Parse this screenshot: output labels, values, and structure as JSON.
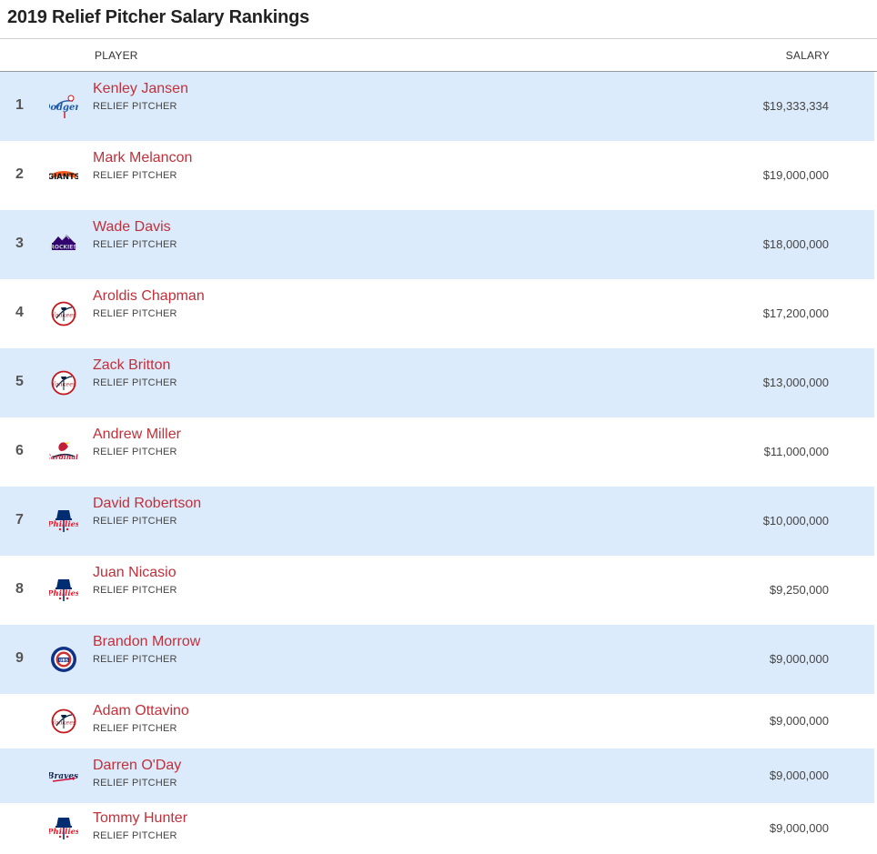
{
  "page": {
    "title": "2019 Relief Pitcher Salary Rankings"
  },
  "table": {
    "headers": {
      "player": "PLAYER",
      "salary": "SALARY"
    },
    "rows": [
      {
        "rank": "1",
        "name": "Kenley Jansen",
        "position": "RELIEF PITCHER",
        "salary": "$19,333,334",
        "team_icon": "dodgers-logo-icon"
      },
      {
        "rank": "2",
        "name": "Mark Melancon",
        "position": "RELIEF PITCHER",
        "salary": "$19,000,000",
        "team_icon": "giants-logo-icon"
      },
      {
        "rank": "3",
        "name": "Wade Davis",
        "position": "RELIEF PITCHER",
        "salary": "$18,000,000",
        "team_icon": "rockies-logo-icon"
      },
      {
        "rank": "4",
        "name": "Aroldis Chapman",
        "position": "RELIEF PITCHER",
        "salary": "$17,200,000",
        "team_icon": "yankees-logo-icon"
      },
      {
        "rank": "5",
        "name": "Zack Britton",
        "position": "RELIEF PITCHER",
        "salary": "$13,000,000",
        "team_icon": "yankees-logo-icon"
      },
      {
        "rank": "6",
        "name": "Andrew Miller",
        "position": "RELIEF PITCHER",
        "salary": "$11,000,000",
        "team_icon": "cardinals-logo-icon"
      },
      {
        "rank": "7",
        "name": "David Robertson",
        "position": "RELIEF PITCHER",
        "salary": "$10,000,000",
        "team_icon": "phillies-logo-icon"
      },
      {
        "rank": "8",
        "name": "Juan Nicasio",
        "position": "RELIEF PITCHER",
        "salary": "$9,250,000",
        "team_icon": "phillies-logo-icon"
      },
      {
        "rank": "9",
        "name": "Brandon Morrow",
        "position": "RELIEF PITCHER",
        "salary": "$9,000,000",
        "team_icon": "cubs-logo-icon"
      },
      {
        "rank": "",
        "name": "Adam Ottavino",
        "position": "RELIEF PITCHER",
        "salary": "$9,000,000",
        "team_icon": "yankees-logo-icon"
      },
      {
        "rank": "",
        "name": "Darren O'Day",
        "position": "RELIEF PITCHER",
        "salary": "$9,000,000",
        "team_icon": "braves-logo-icon"
      },
      {
        "rank": "",
        "name": "Tommy Hunter",
        "position": "RELIEF PITCHER",
        "salary": "$9,000,000",
        "team_icon": "phillies-logo-icon"
      }
    ]
  },
  "colors": {
    "row_shaded": "#dcebfb",
    "player_link": "#c0303a",
    "dodgers_blue": "#1f5aa6",
    "giants_orange": "#fd5a1e",
    "rockies_purple": "#33006f",
    "yankees_red": "#c4161c",
    "yankees_navy": "#0c2340",
    "cardinals_red": "#c41e3a",
    "phillies_red": "#e81828",
    "phillies_blue": "#002d72",
    "cubs_blue": "#0e3386",
    "braves_navy": "#13274f"
  }
}
